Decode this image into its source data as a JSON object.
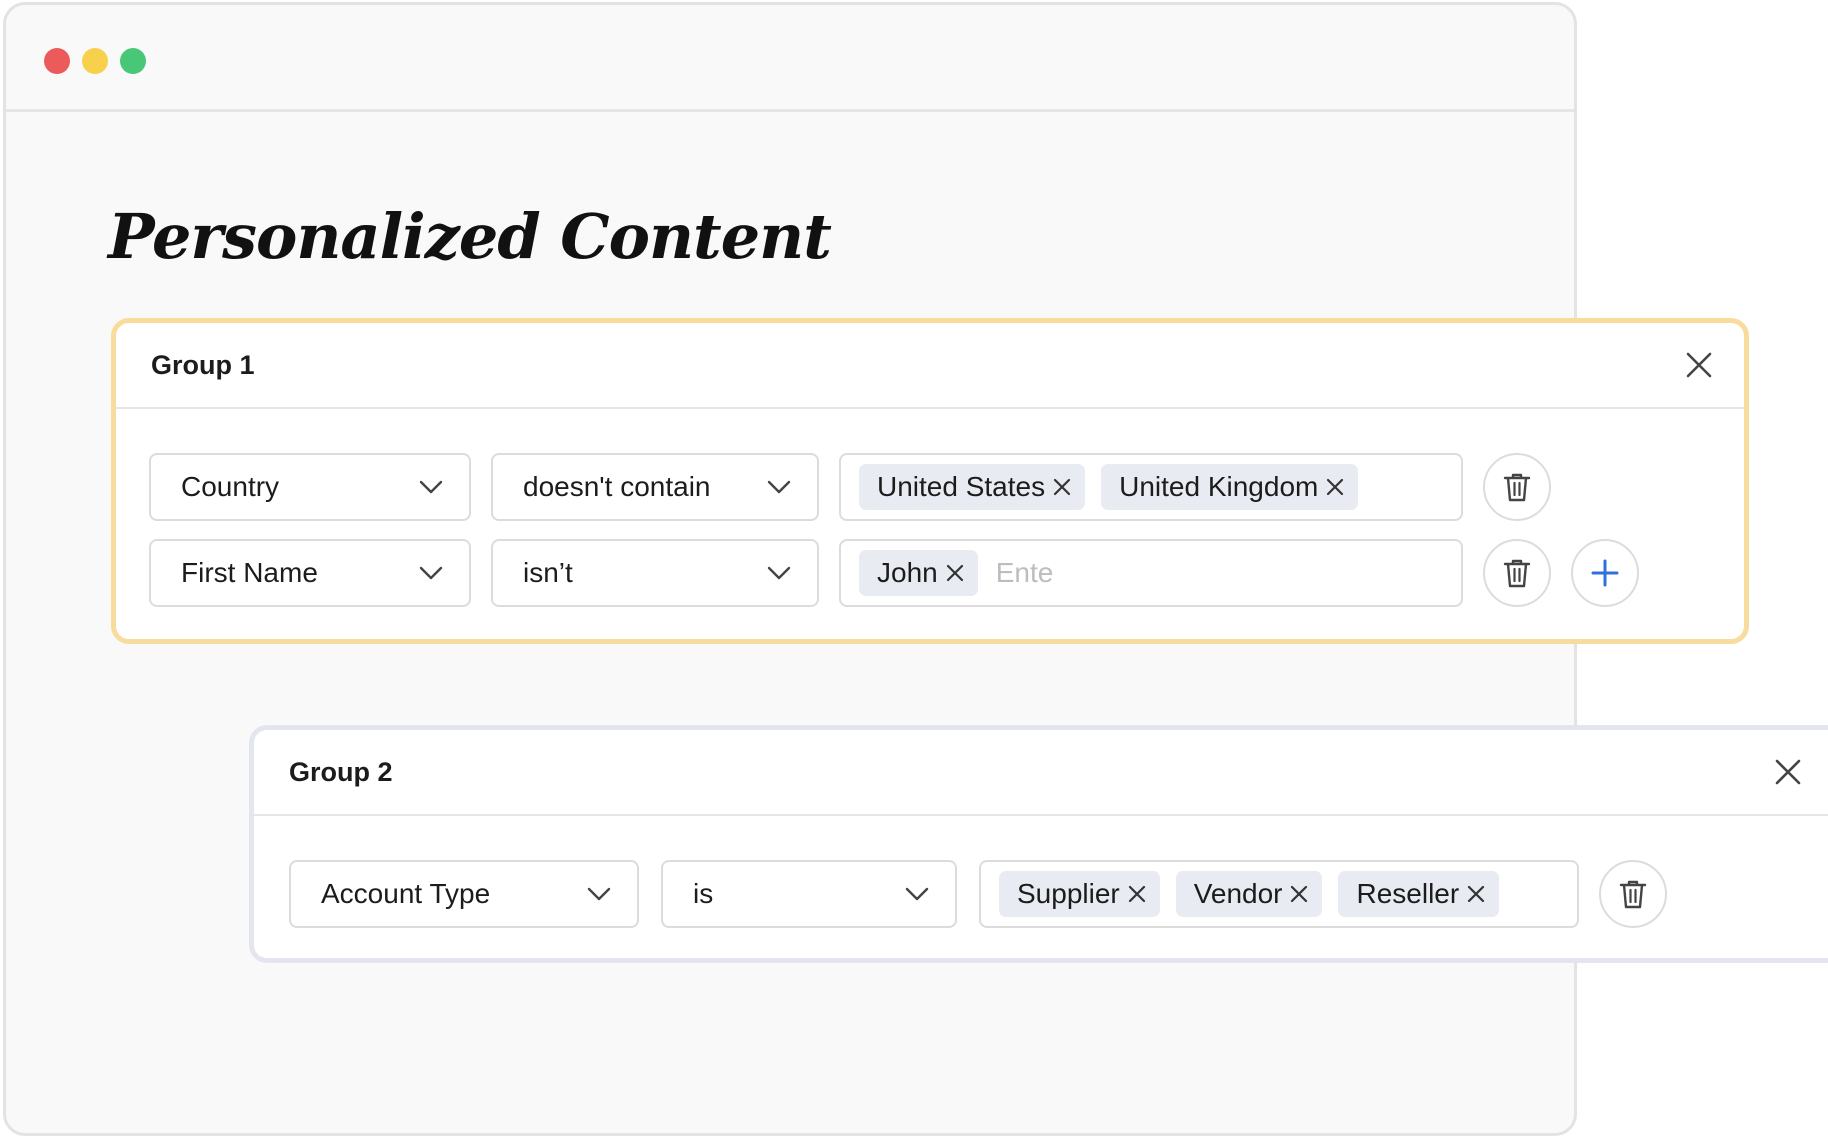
{
  "page": {
    "title": "Personalized Content"
  },
  "groups": [
    {
      "title": "Group 1",
      "rows": [
        {
          "field": "Country",
          "operator": "doesn't contain",
          "tags": [
            "United States",
            "United Kingdom"
          ]
        },
        {
          "field": "First Name",
          "operator": "isn’t",
          "tags": [
            "John"
          ],
          "input_value": "",
          "input_placeholder": "Ente"
        }
      ]
    },
    {
      "title": "Group 2",
      "rows": [
        {
          "field": "Account Type",
          "operator": "is",
          "tags": [
            "Supplier",
            "Vendor",
            "Reseller"
          ]
        }
      ]
    }
  ],
  "colors": {
    "group1_border": "#f8dc9e",
    "group2_border": "#e4e6ef",
    "tag_bg": "#e8ebf1",
    "add_icon": "#2f6fde",
    "traffic_red": "#ec5b5b",
    "traffic_yellow": "#f7d14c",
    "traffic_green": "#48c876"
  },
  "icons": [
    "close-icon",
    "chevron-down-icon",
    "tag-remove-icon",
    "trash-icon",
    "plus-icon"
  ]
}
